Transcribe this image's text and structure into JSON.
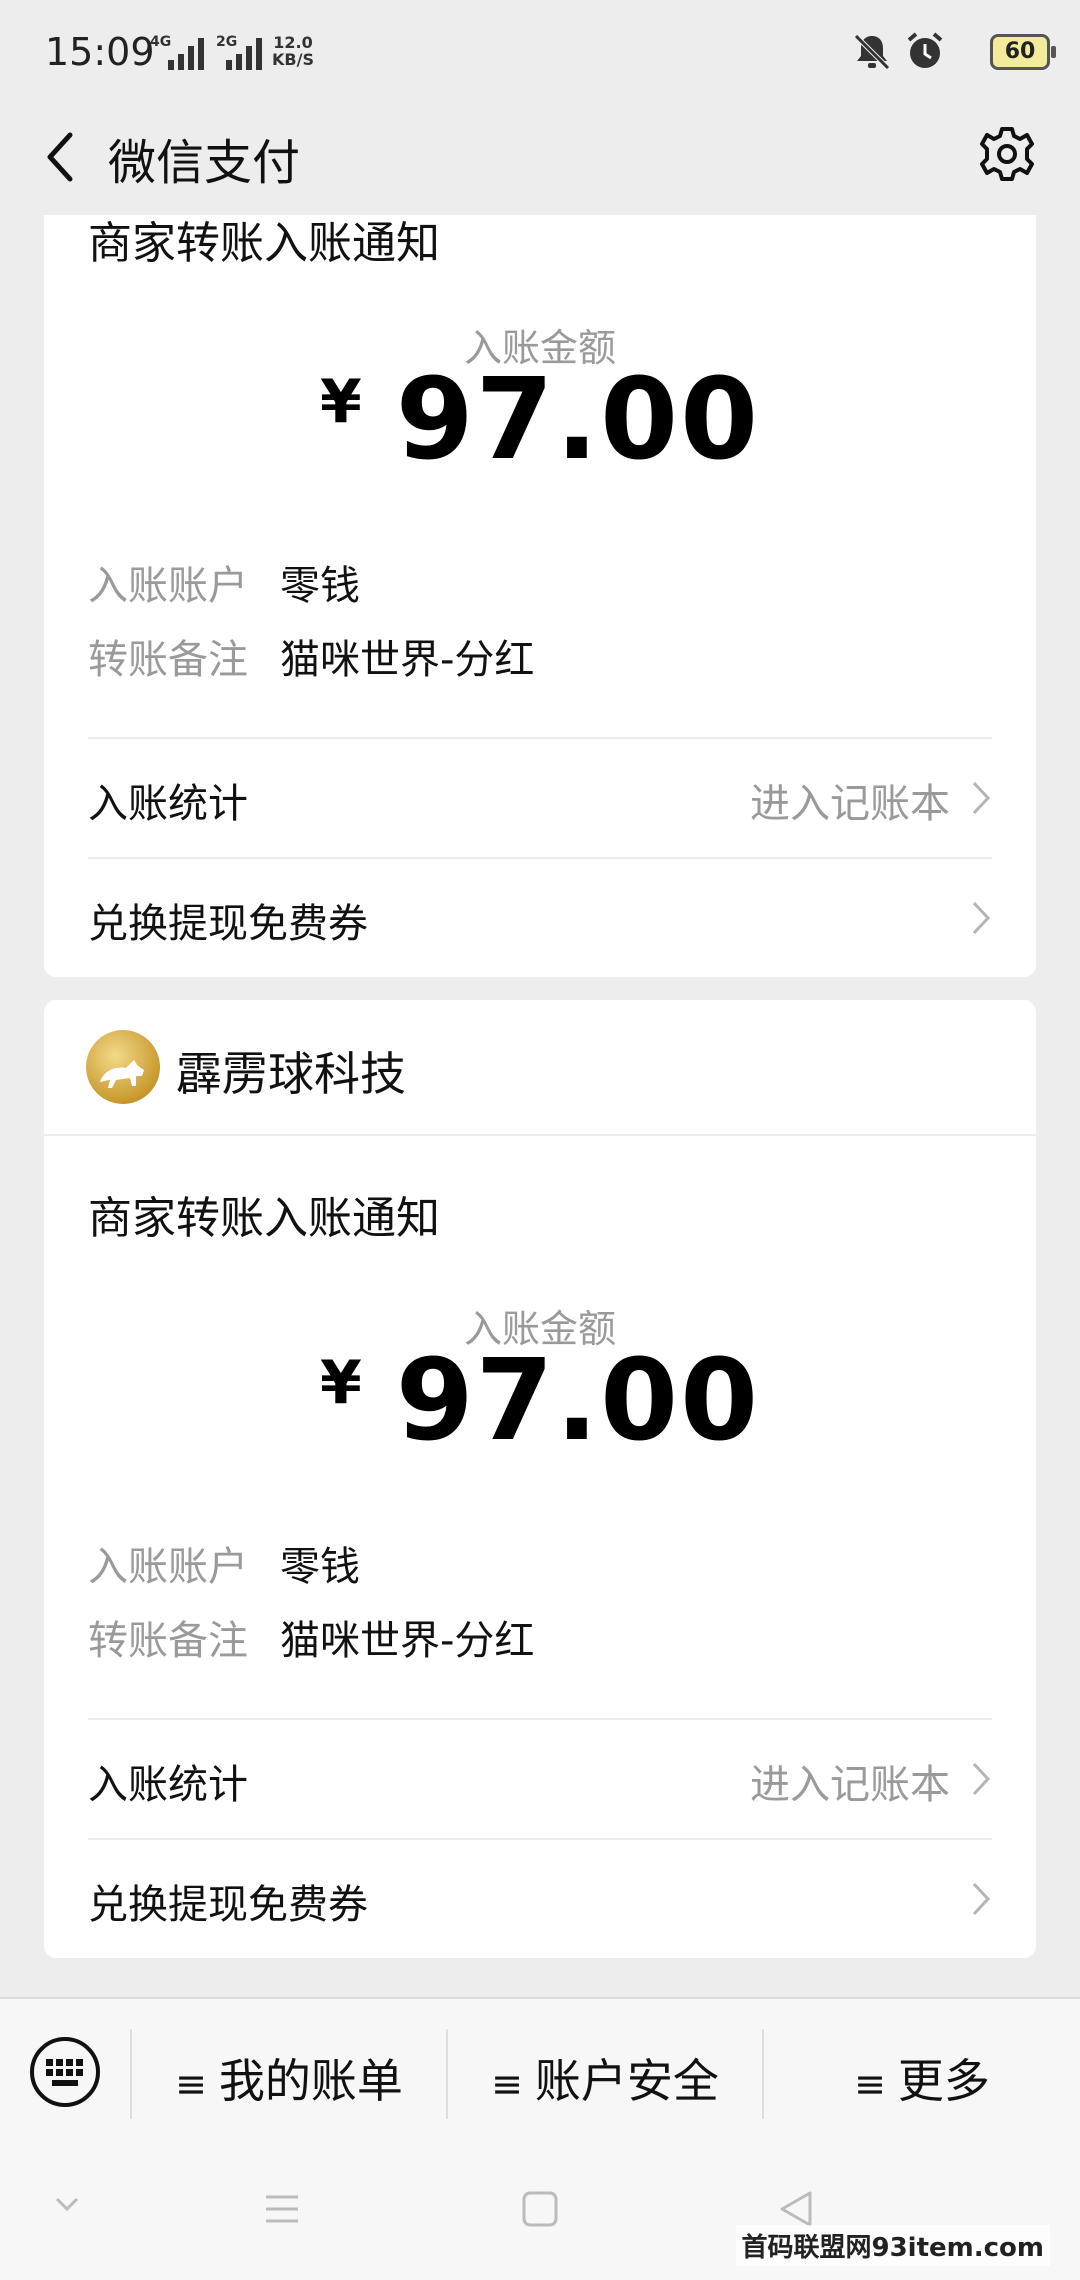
{
  "status_bar": {
    "time": "15:09",
    "signal1_label": "4G",
    "signal2_label": "2G",
    "speed_value": "12.0",
    "speed_unit": "KB/S",
    "battery": "60"
  },
  "nav": {
    "title": "微信支付"
  },
  "cards": [
    {
      "section_title": "商家转账入账通知",
      "amount_label": "入账金额",
      "currency": "¥",
      "amount": "97.00",
      "account_label": "入账账户",
      "account_value": "零钱",
      "note_label": "转账备注",
      "note_value": "猫咪世界-分红",
      "stats_label": "入账统计",
      "stats_hint": "进入记账本",
      "coupon_label": "兑换提现免费券"
    },
    {
      "merchant_name": "霹雳球科技",
      "section_title": "商家转账入账通知",
      "amount_label": "入账金额",
      "currency": "¥",
      "amount": "97.00",
      "account_label": "入账账户",
      "account_value": "零钱",
      "note_label": "转账备注",
      "note_value": "猫咪世界-分红",
      "stats_label": "入账统计",
      "stats_hint": "进入记账本",
      "coupon_label": "兑换提现免费券"
    }
  ],
  "menu": {
    "items": [
      {
        "label": "我的账单"
      },
      {
        "label": "账户安全"
      },
      {
        "label": "更多"
      }
    ]
  },
  "watermark": "首码联盟网93item.com"
}
